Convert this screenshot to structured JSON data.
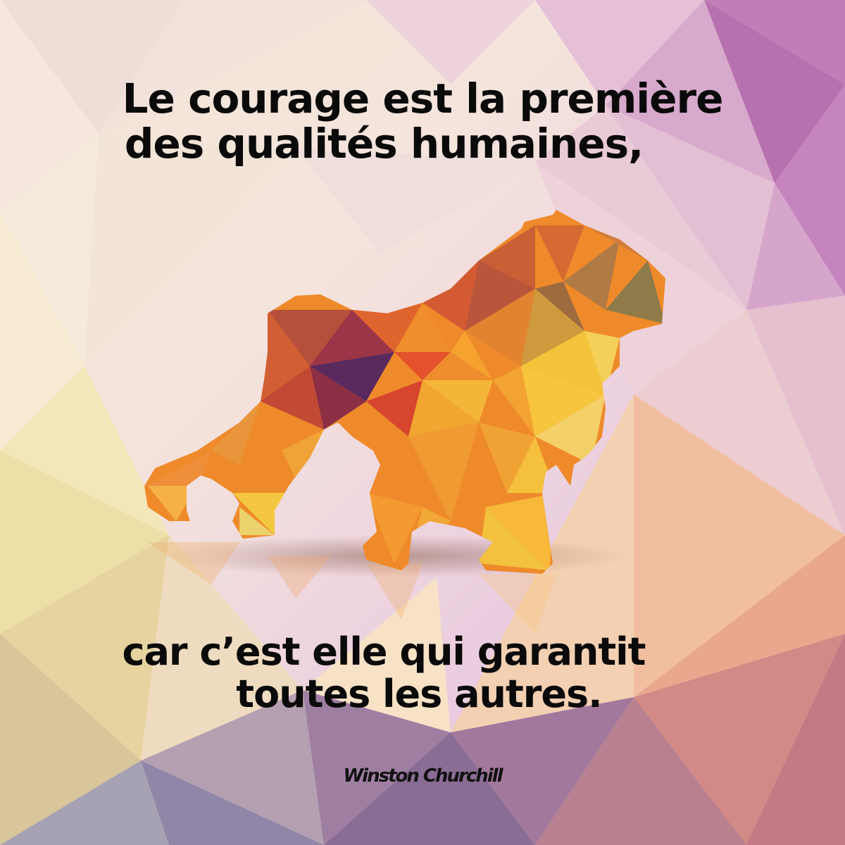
{
  "quote": {
    "line1": "Le courage est la première",
    "line2": "des qualités humaines,",
    "line3": "car  c’est elle qui garantit",
    "line4": "toutes les autres."
  },
  "author": "Winston Churchill",
  "colors": {
    "text": "#0a0a0a",
    "lion_orange": "#ee8a2a",
    "lion_yellow": "#f5c33a",
    "lion_red": "#d7452e",
    "lion_purple": "#5a2a5e",
    "bg_pink": "#e8c4dc",
    "bg_purple": "#b46eae",
    "bg_cream": "#f6ead6"
  },
  "illustration": {
    "subject": "lion-icon",
    "style": "low-poly"
  }
}
